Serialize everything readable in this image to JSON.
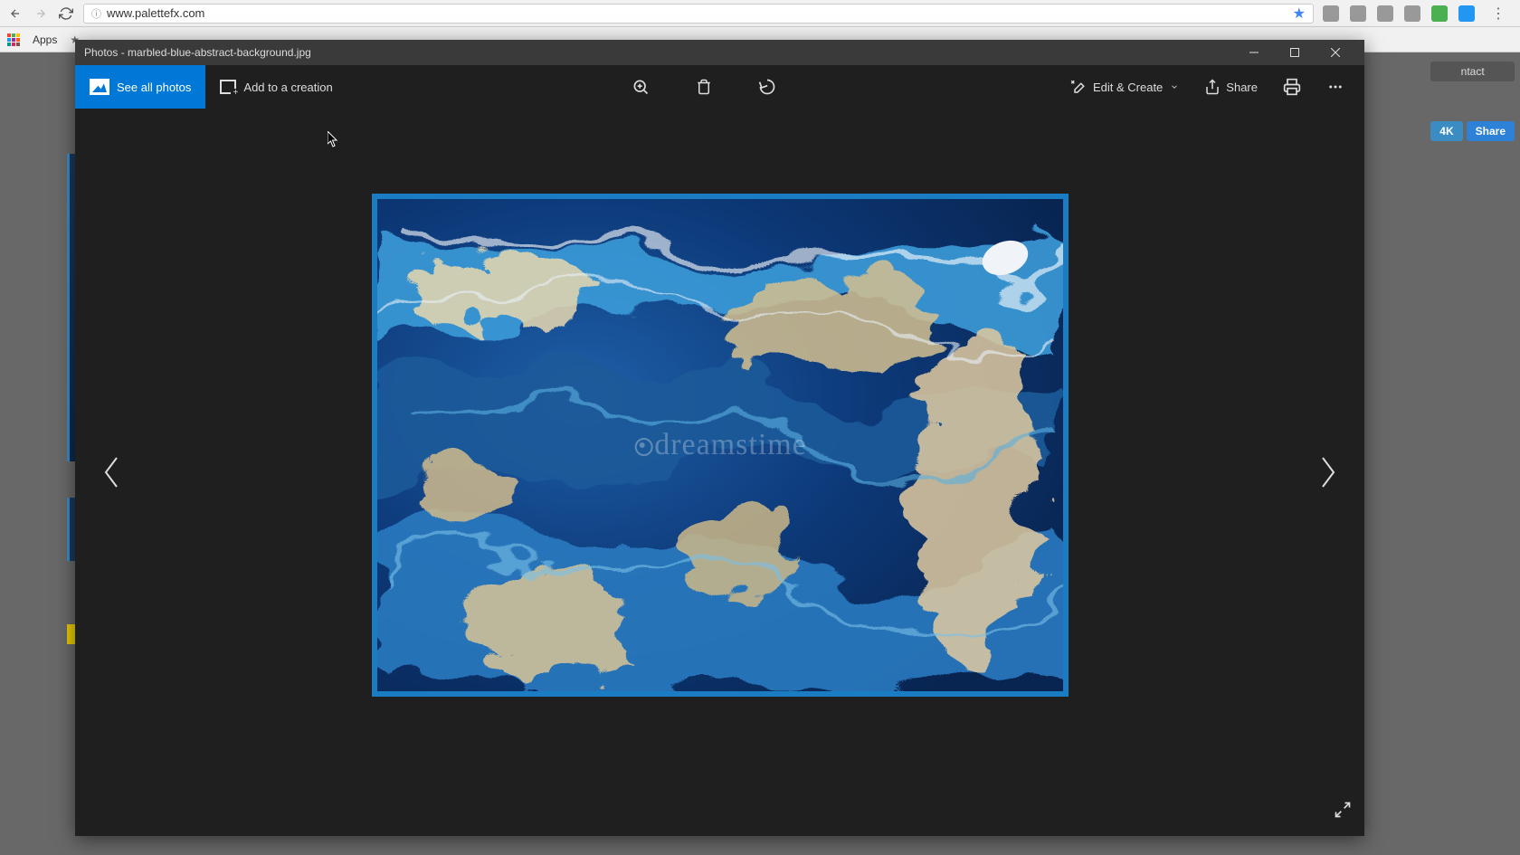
{
  "browser": {
    "url": "www.palettefx.com",
    "bookmarks": {
      "apps_label": "Apps"
    }
  },
  "page_background": {
    "peek_contact": "ntact",
    "peek_4k": "4K",
    "peek_share": "Share"
  },
  "photos": {
    "title": "Photos - marbled-blue-abstract-background.jpg",
    "toolbar": {
      "see_all": "See all photos",
      "add_creation": "Add to a creation",
      "edit_create": "Edit & Create",
      "share": "Share"
    },
    "watermark": "dreamstime"
  }
}
